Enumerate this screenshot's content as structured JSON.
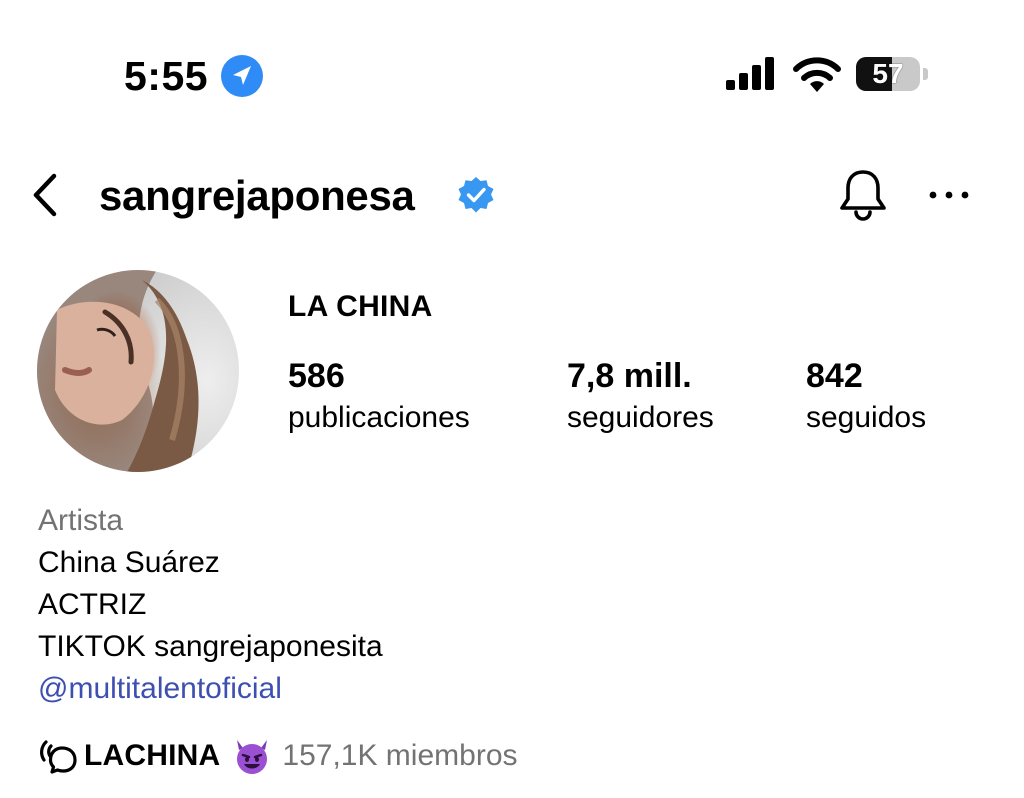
{
  "status_bar": {
    "time": "5:55",
    "battery_level": 57,
    "battery_text": "57",
    "icons": [
      "location-arrow-icon",
      "cellular-signal-icon",
      "wifi-icon",
      "battery-icon"
    ]
  },
  "header": {
    "username": "sangrejaponesa",
    "verified": true,
    "icons": [
      "back-chevron-icon",
      "verified-badge-icon",
      "bell-icon",
      "more-dots-icon"
    ],
    "accent_color": "#3897f0"
  },
  "profile": {
    "display_name": "LA CHINA",
    "stats": {
      "posts": {
        "value": "586",
        "label": "publicaciones"
      },
      "followers": {
        "value": "7,8 mill.",
        "label": "seguidores"
      },
      "following": {
        "value": "842",
        "label": "seguidos"
      }
    }
  },
  "bio": {
    "category": "Artista",
    "lines": [
      "China Suárez",
      "ACTRIZ",
      "TIKTOK sangrejaponesita"
    ],
    "link": "@multitalentoficial",
    "link_color": "#3d4fb0"
  },
  "channel": {
    "icon": "broadcast-channel-icon",
    "name": "LACHINA",
    "emoji_icon": "smiling-devil-emoji-icon",
    "members": "157,1K miembros"
  }
}
